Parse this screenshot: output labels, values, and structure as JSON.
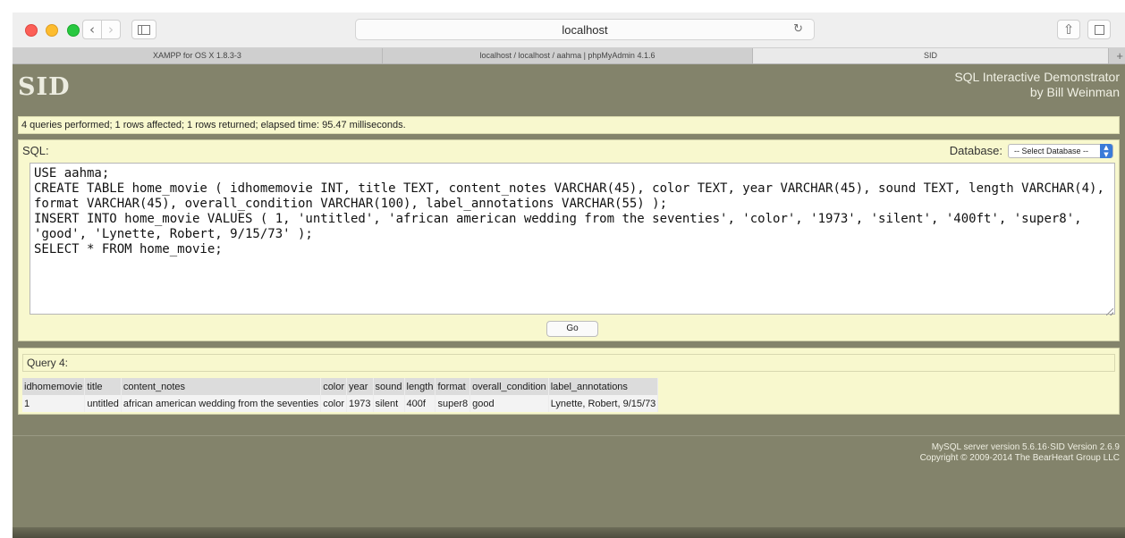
{
  "browser": {
    "address": "localhost",
    "tabs": [
      "XAMPP for OS X 1.8.3-3",
      "localhost / localhost / aahma | phpMyAdmin 4.1.6",
      "SID"
    ],
    "icons": {
      "back": "chevron-left-icon",
      "forward": "chevron-right-icon",
      "sidebar": "sidebar-icon",
      "reload": "reload-icon",
      "share": "share-icon",
      "tabs": "tabs-icon",
      "new_tab": "plus-icon"
    }
  },
  "app": {
    "logo": "SID",
    "tagline_line1": "SQL Interactive Demonstrator",
    "tagline_line2": "by Bill Weinman"
  },
  "status": "4 queries performed; 1 rows affected; 1 rows returned; elapsed time: 95.47 milliseconds.",
  "sql_panel": {
    "label": "SQL:",
    "database_label": "Database:",
    "database_select": "-- Select Database --",
    "query_text": "USE aahma;\nCREATE TABLE home_movie ( idhomemovie INT, title TEXT, content_notes VARCHAR(45), color TEXT, year VARCHAR(45), sound TEXT, length VARCHAR(4), format VARCHAR(45), overall_condition VARCHAR(100), label_annotations VARCHAR(55) );\nINSERT INTO home_movie VALUES ( 1, 'untitled', 'african american wedding from the seventies', 'color', '1973', 'silent', '400ft', 'super8', 'good', 'Lynette, Robert, 9/15/73' );\nSELECT * FROM home_movie;",
    "go_label": "Go"
  },
  "results": {
    "title": "Query 4:",
    "columns": [
      "idhomemovie",
      "title",
      "content_notes",
      "color",
      "year",
      "sound",
      "length",
      "format",
      "overall_condition",
      "label_annotations"
    ],
    "rows": [
      [
        "1",
        "untitled",
        "african american wedding from the seventies",
        "color",
        "1973",
        "silent",
        "400f",
        "super8",
        "good",
        "Lynette, Robert, 9/15/73"
      ]
    ]
  },
  "footer": {
    "line1": "MySQL server version 5.6.16·SID Version 2.6.9",
    "line2": "Copyright © 2009-2014 The BearHeart Group LLC"
  },
  "colors": {
    "page_bg": "#83836b",
    "panel_bg": "#f8f8ce",
    "accent_blue": "#3a7bd8"
  }
}
